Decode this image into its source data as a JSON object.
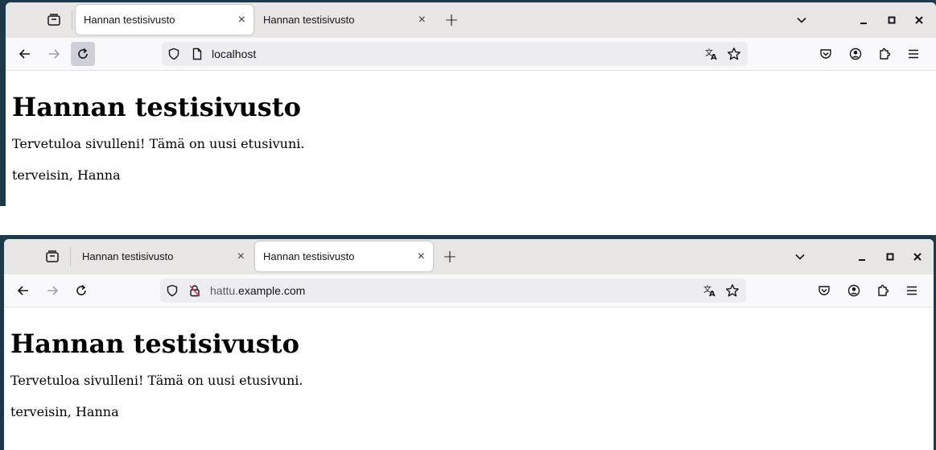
{
  "windows": [
    {
      "tabs": [
        {
          "label": "Hannan testisivusto",
          "active": true
        },
        {
          "label": "Hannan testisivusto",
          "active": false
        }
      ],
      "url": {
        "prefix": "",
        "host": "localhost"
      },
      "page": {
        "heading": "Hannan testisivusto",
        "paragraph1": "Tervetuloa sivulleni! Tämä on uusi etusivuni.",
        "paragraph2": "terveisin, Hanna"
      }
    },
    {
      "tabs": [
        {
          "label": "Hannan testisivusto",
          "active": false
        },
        {
          "label": "Hannan testisivusto",
          "active": true
        }
      ],
      "url": {
        "prefix": "hattu.",
        "host": "example.com"
      },
      "page": {
        "heading": "Hannan testisivusto",
        "paragraph1": "Tervetuloa sivulleni! Tämä on uusi etusivuni.",
        "paragraph2": "terveisin, Hanna"
      }
    }
  ],
  "icons": {
    "tab_close": "×",
    "new_tab": "+",
    "back": "arrow-left-icon",
    "forward": "arrow-right-icon",
    "reload": "reload-icon",
    "shield": "shield-icon",
    "page": "page-icon",
    "insecure_lock": "insecure-lock-icon",
    "translate": "translate-icon",
    "bookmark": "star-icon",
    "pocket": "pocket-icon",
    "account": "account-icon",
    "extensions": "puzzle-icon",
    "menu": "hamburger-menu-icon"
  },
  "colors": {
    "insecure": "#e22850",
    "toolbar": "#f9f9fb",
    "tabstrip": "#e8e6e4"
  }
}
